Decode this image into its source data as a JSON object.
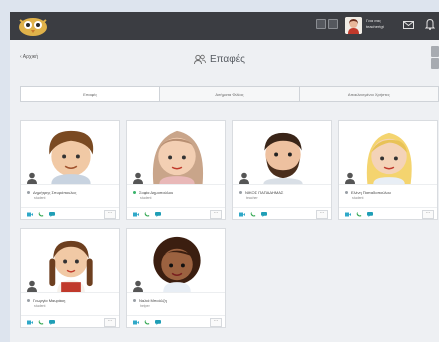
{
  "app": {
    "logo_icon": "owl-logo-icon",
    "colors": {
      "topbar": "#3b3d42",
      "online": "#39b36b",
      "offline": "#9aa0a6",
      "video": "#2fa8c8",
      "phone": "#34a853",
      "chat": "#1f9eb6"
    }
  },
  "header": {
    "user_name_line1": "Γεια σας",
    "user_name_line2": "teachertgt",
    "mail_icon": "mail-icon",
    "bell_icon": "bell-icon"
  },
  "page": {
    "back_label": "‹ Αρχική",
    "title": "Επαφές",
    "title_icon": "contacts-icon"
  },
  "tabs": [
    {
      "label": "Επαφές",
      "active": true
    },
    {
      "label": "Αιτήματα Φιλίας",
      "active": false
    },
    {
      "label": "Αποκλεισμένοι Χρήστες",
      "active": false
    }
  ],
  "contacts": [
    {
      "name": "Δημήτρης Σπυρόπουλος",
      "role": "student",
      "status": "offline",
      "avatar": "boy-brown-hair"
    },
    {
      "name": "Σοφία Δημοπούλου",
      "role": "student",
      "status": "online",
      "avatar": "girl-light-hair"
    },
    {
      "name": "ΝΙΚΟΣ ΠΑΠΑΔΗΜΑΣ",
      "role": "teacher",
      "status": "offline",
      "avatar": "man-beard"
    },
    {
      "name": "Ελένη Παπαδοπούλου",
      "role": "student",
      "status": "offline",
      "avatar": "girl-blonde"
    },
    {
      "name": "Γεωργία Μαυράκη",
      "role": "student",
      "status": "offline",
      "avatar": "girl-braids"
    },
    {
      "name": "Ναλιά Μπούλζη",
      "role": "helper",
      "status": "offline",
      "avatar": "girl-curly"
    }
  ]
}
